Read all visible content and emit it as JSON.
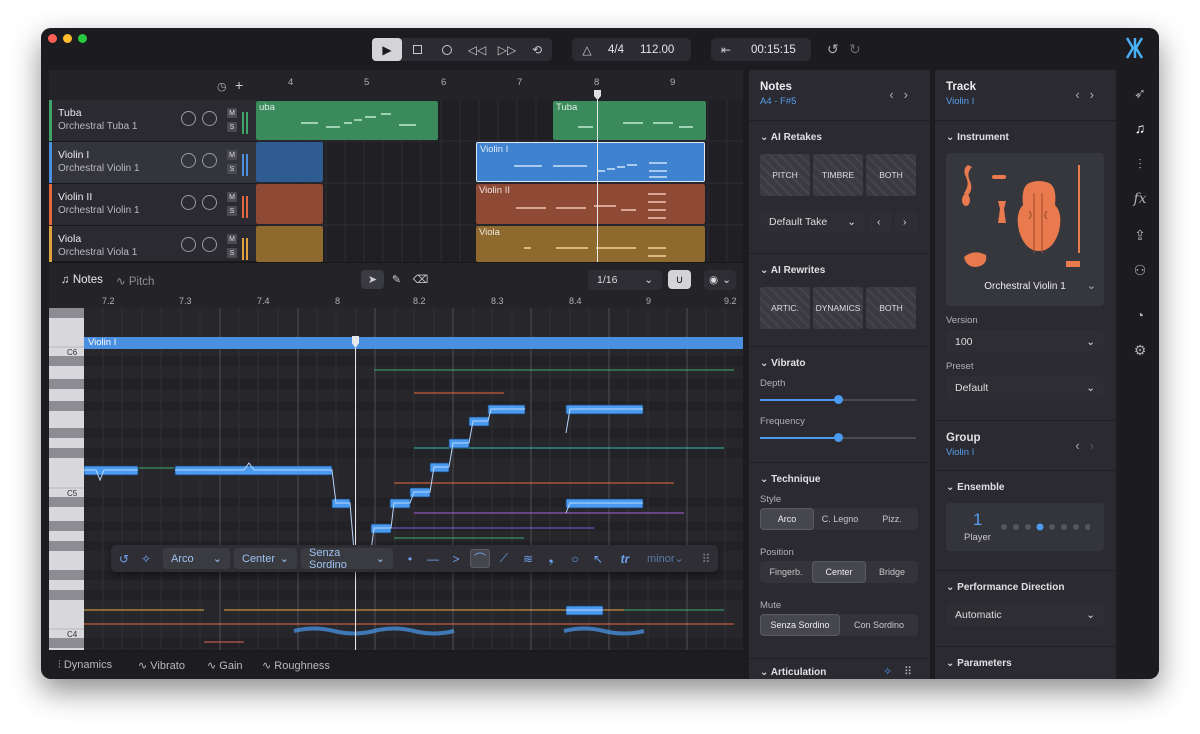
{
  "transport": {
    "time_sig": "4/4",
    "tempo": "112.00",
    "time": "00:15:15"
  },
  "arrange": {
    "ruler": [
      "4",
      "5",
      "6",
      "7",
      "8",
      "9"
    ],
    "tracks": [
      {
        "name": "Tuba",
        "instrument": "Orchestral Tuba 1",
        "color": "#3fa56a"
      },
      {
        "name": "Violin I",
        "instrument": "Orchestral Violin 1",
        "color": "#4a8fe0"
      },
      {
        "name": "Violin II",
        "instrument": "Orchestral Violin 1",
        "color": "#e0673f"
      },
      {
        "name": "Viola",
        "instrument": "Orchestral Viola 1",
        "color": "#e0a23f"
      }
    ],
    "clips": [
      {
        "label": "uba"
      },
      {
        "label": "Tuba"
      },
      {
        "label": "Violin I"
      },
      {
        "label": "Violin II"
      },
      {
        "label": "Viola"
      }
    ],
    "mute_label": "M",
    "solo_label": "S"
  },
  "editor": {
    "tab_notes": "Notes",
    "tab_pitch": "Pitch",
    "quantize": "1/16",
    "ruler": [
      "7.2",
      "7.3",
      "7.4",
      "8",
      "8.2",
      "8.3",
      "8.4",
      "9",
      "9.2"
    ],
    "region_label": "Violin I",
    "octaves": [
      "C6",
      "C5",
      "C4"
    ],
    "toolbar": {
      "style": "Arco",
      "position": "Center",
      "mute": "Senza Sordino",
      "scale": "minor"
    },
    "bottom_tabs": [
      "Dynamics",
      "Vibrato",
      "Gain",
      "Roughness"
    ]
  },
  "notes_panel": {
    "title": "Notes",
    "subtitle": "A4 - F#5",
    "ai_retakes": {
      "title": "AI Retakes",
      "buttons": [
        "PITCH",
        "TIMBRE",
        "BOTH"
      ],
      "take": "Default Take"
    },
    "ai_rewrites": {
      "title": "AI Rewrites",
      "buttons": [
        "ARTIC.",
        "DYNAMICS",
        "BOTH"
      ]
    },
    "vibrato": {
      "title": "Vibrato",
      "depth_label": "Depth",
      "depth": 0.52,
      "frequency_label": "Frequency",
      "frequency": 0.52
    },
    "technique": {
      "title": "Technique",
      "style_label": "Style",
      "style_options": [
        "Arco",
        "C. Legno",
        "Pizz."
      ],
      "position_label": "Position",
      "position_options": [
        "Fingerb.",
        "Center",
        "Bridge"
      ],
      "mute_label": "Mute",
      "mute_options": [
        "Senza Sordino",
        "Con Sordino"
      ]
    },
    "articulation": {
      "title": "Articulation"
    }
  },
  "track_panel": {
    "title": "Track",
    "subtitle": "Violin I",
    "instrument_title": "Instrument",
    "instrument_name": "Orchestral Violin 1",
    "version_label": "Version",
    "version": "100",
    "preset_label": "Preset",
    "preset": "Default",
    "group_title": "Group",
    "group_sub": "Violin I",
    "ensemble_title": "Ensemble",
    "players": "1",
    "player_label": "Player",
    "perf_title": "Performance Direction",
    "perf_value": "Automatic",
    "params_title": "Parameters"
  },
  "colors": {
    "accent": "#4a9bf0",
    "tuba": "#3fa56a",
    "violin1": "#4a8fe0",
    "violin2": "#e0673f",
    "viola": "#e0a23f"
  }
}
